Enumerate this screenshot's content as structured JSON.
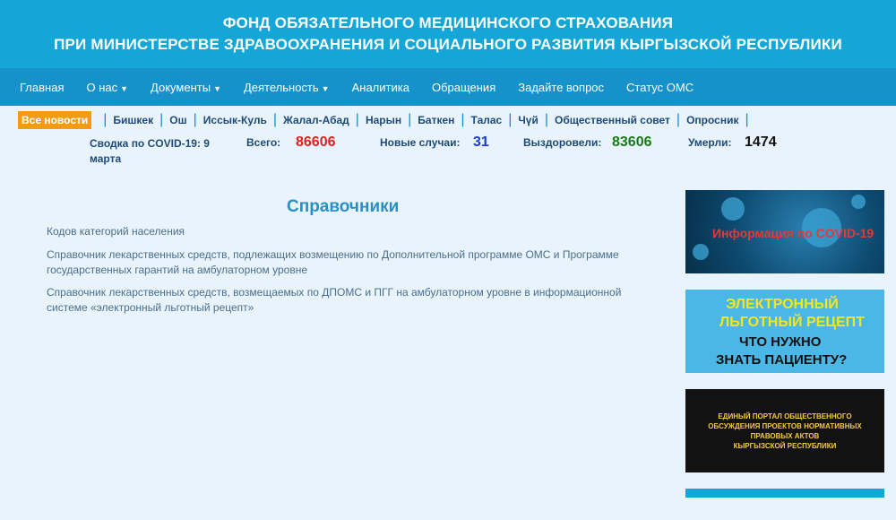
{
  "header": {
    "line1": "ФОНД ОБЯЗАТЕЛЬНОГО МЕДИЦИНСКОГО СТРАХОВАНИЯ",
    "line2": "ПРИ МИНИСТЕРСТВЕ ЗДРАВООХРАНЕНИЯ И СОЦИАЛЬНОГО РАЗВИТИЯ КЫРГЫЗСКОЙ РЕСПУБЛИКИ"
  },
  "nav": {
    "items": [
      {
        "label": "Главная"
      },
      {
        "label": "О нас"
      },
      {
        "label": "Документы"
      },
      {
        "label": "Деятельность"
      },
      {
        "label": "Аналитика"
      },
      {
        "label": "Обращения"
      },
      {
        "label": "Задайте вопрос"
      },
      {
        "label": "Статус ОМС"
      }
    ]
  },
  "regions": {
    "all_news": "Все новости",
    "items": [
      "Бишкек",
      "Ош",
      "Иссык-Куль",
      "Жалал-Абад",
      "Нарын",
      "Баткен",
      "Талас",
      "Чүй",
      "Общественный совет",
      "Опросник"
    ]
  },
  "covid": {
    "title": "Сводка по COVID-19: 9 марта",
    "total_label": "Всего:",
    "total": "86606",
    "new_label": "Новые случаи:",
    "new": "31",
    "recovered_label": "Выздоровели:",
    "recovered": "83606",
    "died_label": "Умерли:",
    "died": "1474",
    "colors": {
      "total": "#e02020",
      "new": "#1a3bd6",
      "recovered": "#1a7a1a",
      "died": "#111111"
    }
  },
  "main": {
    "title": "Справочники",
    "links": [
      "Кодов категорий населения",
      "Справочник лекарственных средств, подлежащих возмещению по Дополнительной программе ОМС и Программе государственных гарантий на амбулаторном уровне",
      "Справочник лекарственных средств, возмещаемых по ДПОМС и ПГГ на амбулаторном уровне в информационной системе «электронный льготный рецепт»"
    ]
  },
  "sidebar": {
    "covid_banner": "Информация по COVID-19",
    "recipe_banner": {
      "line1": "ЭЛЕКТРОННЫЙ",
      "line2": "ЛЬГОТНЫЙ РЕЦЕПТ",
      "line3": "ЧТО НУЖНО",
      "line4": "ЗНАТЬ ПАЦИЕНТУ?"
    },
    "portal_banner": {
      "line1": "ЕДИНЫЙ ПОРТАЛ ОБЩЕСТВЕННОГО",
      "line2": "ОБСУЖДЕНИЯ ПРОЕКТОВ НОРМАТИВНЫХ",
      "line3": "ПРАВОВЫХ АКТОВ",
      "line4": "КЫРГЫЗСКОЙ РЕСПУБЛИКИ"
    }
  }
}
